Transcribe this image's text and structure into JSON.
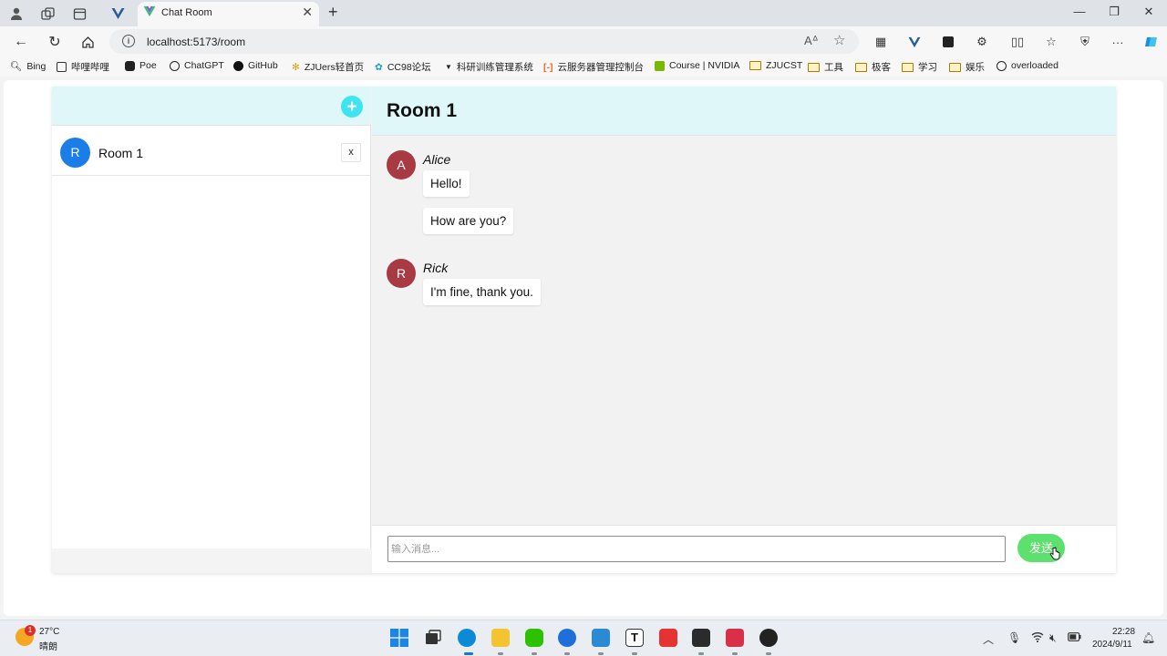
{
  "browser": {
    "tab_title": "Chat Room",
    "url": "localhost:5173/room",
    "bookmarks": [
      {
        "label": "Bing"
      },
      {
        "label": "哔哩哔哩"
      },
      {
        "label": "Poe"
      },
      {
        "label": "ChatGPT"
      },
      {
        "label": "GitHub"
      },
      {
        "label": "ZJUers轻首页"
      },
      {
        "label": "CC98论坛"
      },
      {
        "label": "科研训练管理系统"
      },
      {
        "label": "云服务器管理控制台"
      },
      {
        "label": "Course | NVIDIA"
      },
      {
        "label": "ZJUCST"
      },
      {
        "label": "工具"
      },
      {
        "label": "极客"
      },
      {
        "label": "学习"
      },
      {
        "label": "娱乐"
      },
      {
        "label": "overloaded"
      }
    ]
  },
  "sidebar": {
    "add_label": "+",
    "rooms": [
      {
        "avatar": "R",
        "name": "Room 1",
        "close_label": "x"
      }
    ]
  },
  "chat": {
    "title": "Room 1",
    "messages": [
      {
        "avatar": "A",
        "author": "Alice",
        "texts": [
          "Hello!",
          "How are you?"
        ]
      },
      {
        "avatar": "R",
        "author": "Rick",
        "texts": [
          "I'm fine, thank you."
        ]
      }
    ],
    "input_placeholder": "输入消息...",
    "send_label": "发送"
  },
  "taskbar": {
    "weather_temp": "27°C",
    "weather_desc": "晴朗",
    "weather_badge": "1",
    "time": "22:28",
    "date": "2024/9/11"
  },
  "colors": {
    "header_bg": "#e0f7fa",
    "add_button": "#3ee5f0",
    "room_avatar": "#1a7de8",
    "user_avatar": "#a83a44",
    "send_button": "#5ee06e"
  }
}
